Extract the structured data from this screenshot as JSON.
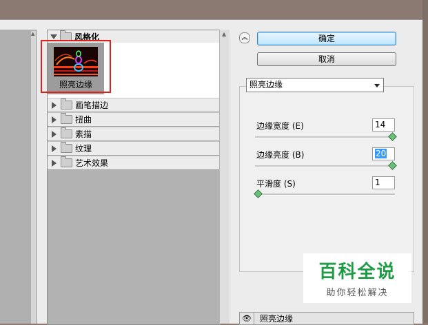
{
  "filter_list": {
    "category_open": "风格化",
    "thumbnail_label": "照亮边缘",
    "categories": [
      {
        "label": "画笔描边"
      },
      {
        "label": "扭曲"
      },
      {
        "label": "素描"
      },
      {
        "label": "纹理"
      },
      {
        "label": "艺术效果"
      }
    ]
  },
  "buttons": {
    "ok": "确定",
    "cancel": "取消"
  },
  "settings": {
    "selected_filter": "照亮边缘",
    "params": [
      {
        "label": "边缘宽度 (E)",
        "value": "14",
        "level_fraction": 1.0
      },
      {
        "label": "边缘亮度 (B)",
        "value": "20",
        "level_fraction": 1.0
      },
      {
        "label": "平滑度 (S)",
        "value": "1",
        "level_fraction": 0.0
      }
    ]
  },
  "layer": {
    "label": "照亮边缘"
  },
  "watermark": {
    "title": "百科全说",
    "subtitle": "助你轻松解决"
  },
  "colors": {
    "accent_red": "#e0201a",
    "watermark_green": "#1f9b46"
  }
}
